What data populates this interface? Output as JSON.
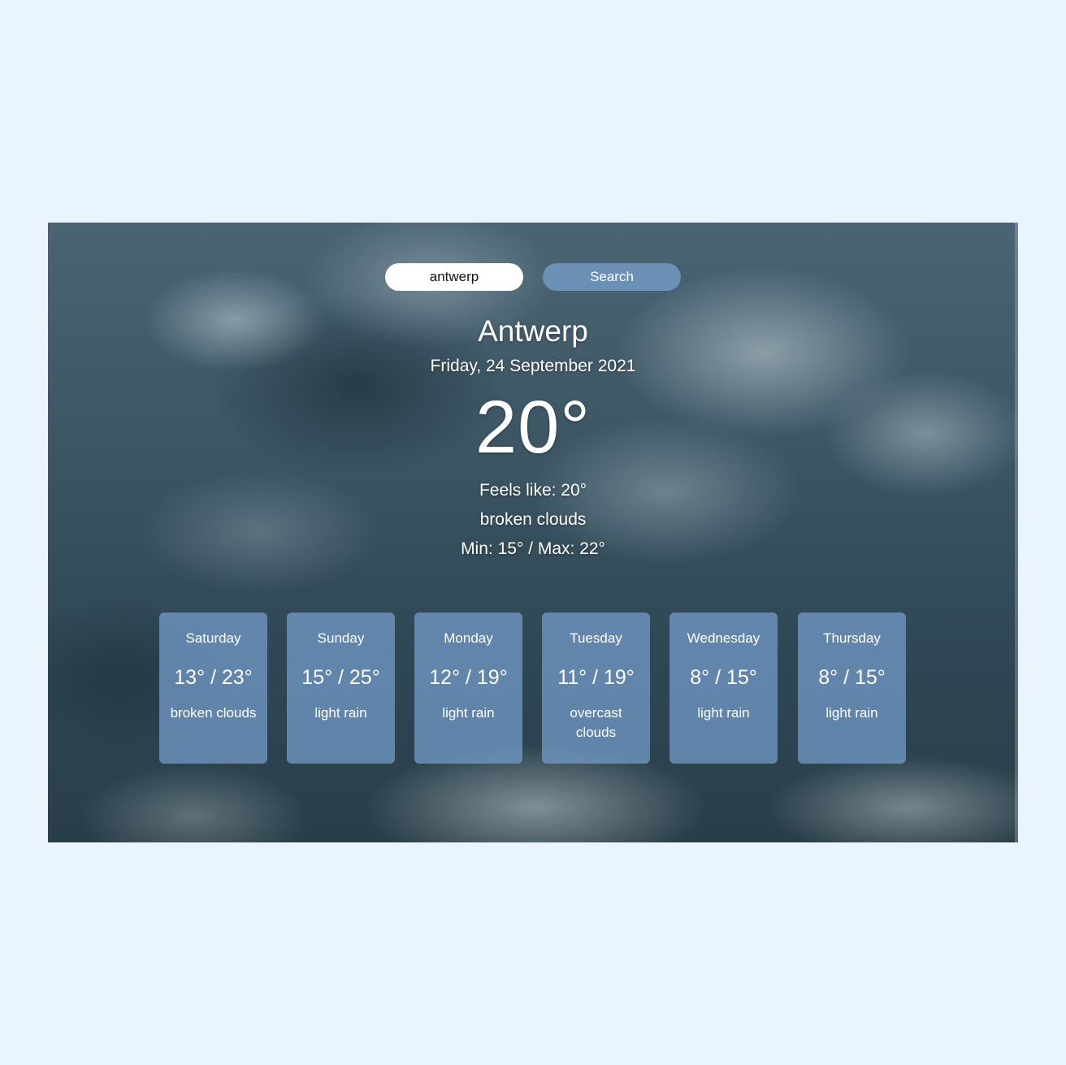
{
  "search": {
    "value": "antwerp",
    "button_label": "Search"
  },
  "current": {
    "city": "Antwerp",
    "date": "Friday, 24 September 2021",
    "temperature": "20°",
    "feels_like": "Feels like: 20°",
    "description": "broken clouds",
    "min_max": "Min: 15° / Max: 22°"
  },
  "forecast": [
    {
      "day": "Saturday",
      "temps": "13° / 23°",
      "description": "broken clouds"
    },
    {
      "day": "Sunday",
      "temps": "15° / 25°",
      "description": "light rain"
    },
    {
      "day": "Monday",
      "temps": "12° / 19°",
      "description": "light rain"
    },
    {
      "day": "Tuesday",
      "temps": "11° / 19°",
      "description": "overcast clouds"
    },
    {
      "day": "Wednesday",
      "temps": "8° / 15°",
      "description": "light rain"
    },
    {
      "day": "Thursday",
      "temps": "8° / 15°",
      "description": "light rain"
    }
  ],
  "colors": {
    "page_background": "#eaf4fd",
    "card_background": "#769ecd",
    "button_background": "#78a0cd"
  }
}
